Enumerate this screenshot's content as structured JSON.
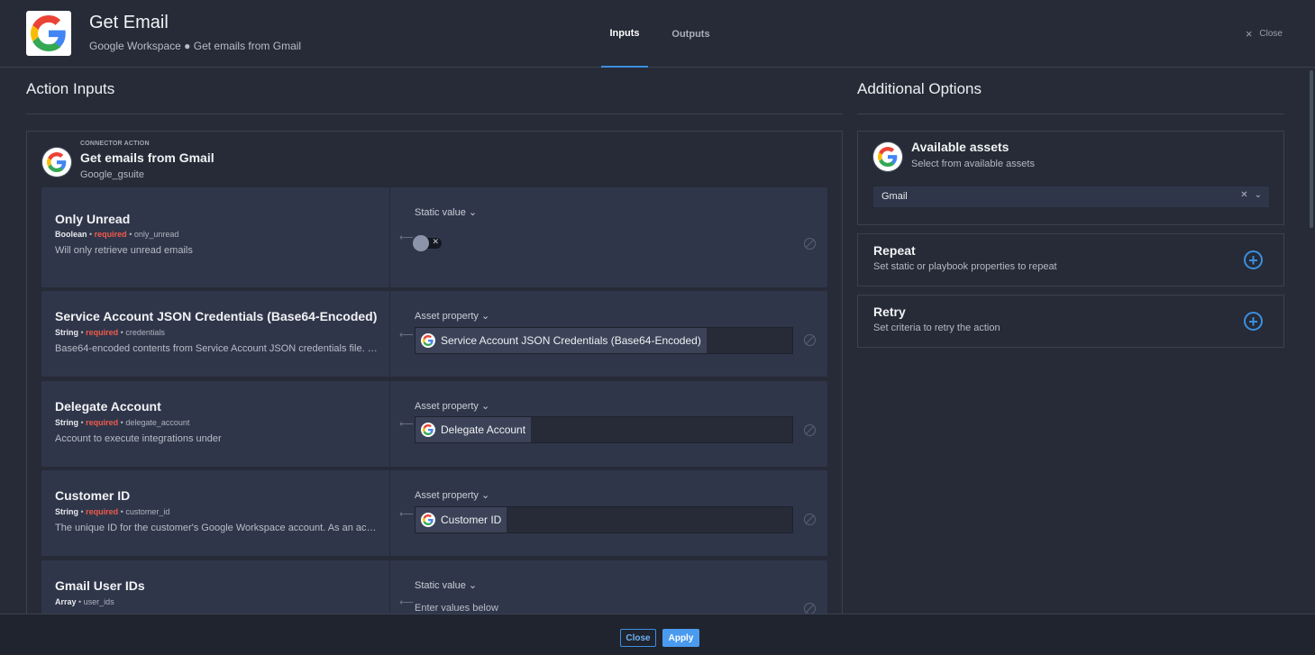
{
  "header": {
    "title": "Get Email",
    "subtitle": "Google Workspace ● Get emails from Gmail",
    "tabs": [
      {
        "label": "Inputs",
        "active": true
      },
      {
        "label": "Outputs",
        "active": false
      }
    ],
    "close_label": "Close"
  },
  "left": {
    "section_title": "Action Inputs",
    "connector": {
      "kicker": "CONNECTOR ACTION",
      "title": "Get emails from Gmail",
      "subtitle": "Google_gsuite"
    },
    "rows": [
      {
        "title": "Only Unread",
        "type": "Boolean",
        "required": "required",
        "key": "only_unread",
        "description": "Will only retrieve unread emails",
        "mode": "Static value ⌄",
        "toggle_on": false
      },
      {
        "title": "Service Account JSON Credentials (Base64-Encoded)",
        "type": "String",
        "required": "required",
        "key": "credentials",
        "description": "Base64-encoded contents from Service Account JSON credentials file. S...",
        "mode": "Asset property ⌄",
        "chip": "Service Account JSON Credentials (Base64-Encoded)"
      },
      {
        "title": "Delegate Account",
        "type": "String",
        "required": "required",
        "key": "delegate_account",
        "description": "Account to execute integrations under",
        "mode": "Asset property ⌄",
        "chip": "Delegate Account"
      },
      {
        "title": "Customer ID",
        "type": "String",
        "required": "required",
        "key": "customer_id",
        "description": "The unique ID for the customer's Google Workspace account. As an acco...",
        "mode": "Asset property ⌄",
        "chip": "Customer ID"
      },
      {
        "title": "Gmail User IDs",
        "type": "Array",
        "key": "user_ids",
        "mode": "Static value ⌄",
        "value_text": "Enter values below"
      }
    ]
  },
  "right": {
    "section_title": "Additional Options",
    "assets": {
      "title": "Available assets",
      "subtitle": "Select from available assets",
      "selected": "Gmail"
    },
    "repeat": {
      "title": "Repeat",
      "subtitle": "Set static or playbook properties to repeat"
    },
    "retry": {
      "title": "Retry",
      "subtitle": "Set criteria to retry the action"
    }
  },
  "footer": {
    "close_label": "Close",
    "apply_label": "Apply"
  },
  "colors": {
    "accent": "#3b8fe0",
    "required": "#f05a4a",
    "background": "#262b37",
    "row": "#30364a"
  }
}
